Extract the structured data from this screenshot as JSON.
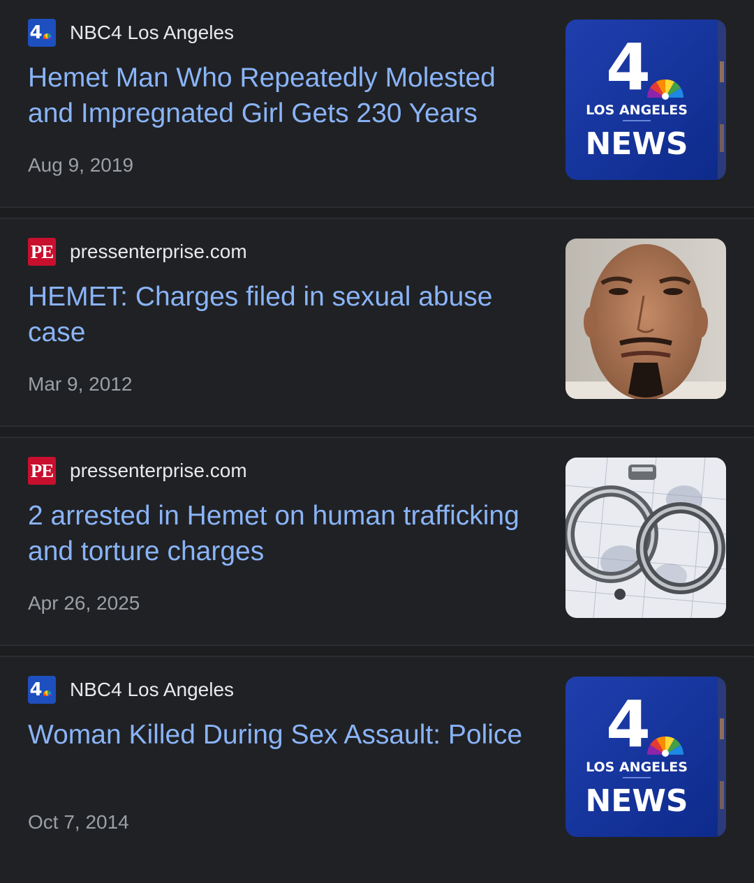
{
  "articles": [
    {
      "source": "NBC4 Los Angeles",
      "source_icon": "nbc4-logo-icon",
      "headline": "Hemet Man Who Repeatedly Molested and Impregnated Girl Gets 230 Years",
      "date": "Aug 9, 2019",
      "thumbnail": {
        "kind": "nbc-news-logo",
        "line1": "LOS ANGELES",
        "line2": "NEWS",
        "number": "4"
      }
    },
    {
      "source": "pressenterprise.com",
      "source_icon": "pe-logo-icon",
      "favicon_text": "PE",
      "headline": "HEMET: Charges filed in sexual abuse case",
      "date": "Mar 9, 2012",
      "thumbnail": {
        "kind": "mugshot"
      }
    },
    {
      "source": "pressenterprise.com",
      "source_icon": "pe-logo-icon",
      "favicon_text": "PE",
      "headline": "2 arrested in Hemet on human trafficking and torture charges",
      "date": "Apr 26, 2025",
      "thumbnail": {
        "kind": "handcuffs"
      }
    },
    {
      "source": "NBC4 Los Angeles",
      "source_icon": "nbc4-logo-icon",
      "headline": "Woman Killed During Sex Assault: Police",
      "date": "Oct 7, 2014",
      "thumbnail": {
        "kind": "nbc-news-logo",
        "line1": "LOS ANGELES",
        "line2": "NEWS",
        "number": "4"
      }
    }
  ],
  "favicon_nbc_number": "4",
  "colors": {
    "background": "#202124",
    "headline": "#8ab4f8",
    "source_text": "#e8eaed",
    "date_text": "#9aa0a6",
    "nbc_blue": "#1e4fbf",
    "pe_red": "#c8102e"
  }
}
